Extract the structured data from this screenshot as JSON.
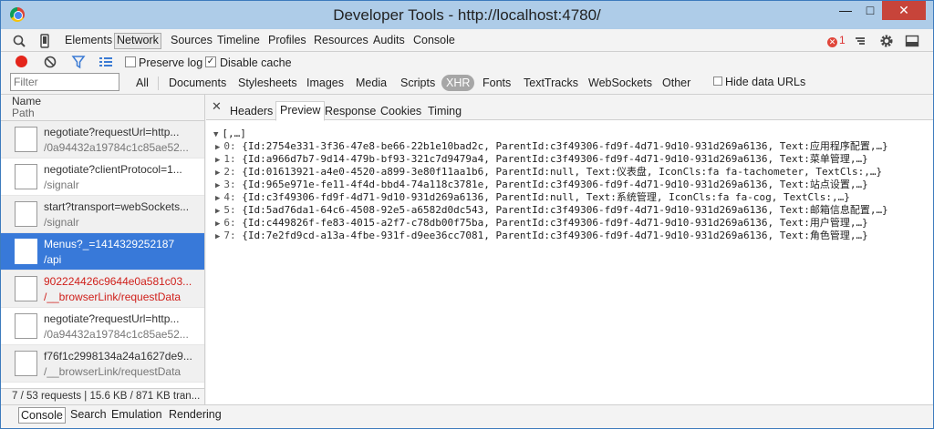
{
  "window": {
    "title": "Developer Tools - http://localhost:4780/"
  },
  "panel_tabs": [
    "Elements",
    "Network",
    "Sources",
    "Timeline",
    "Profiles",
    "Resources",
    "Audits",
    "Console"
  ],
  "error_count": "1",
  "options": {
    "preserve_log": "Preserve log",
    "disable_cache": "Disable cache"
  },
  "filter": {
    "placeholder": "Filter"
  },
  "filter_types": [
    "All",
    "Documents",
    "Stylesheets",
    "Images",
    "Media",
    "Scripts",
    "XHR",
    "Fonts",
    "TextTracks",
    "WebSockets",
    "Other"
  ],
  "hide_data_urls": "Hide data URLs",
  "list": {
    "header_name": "Name",
    "header_path": "Path",
    "requests": [
      {
        "name": "negotiate?requestUrl=http...",
        "path": "/0a94432a19784c1c85ae52..."
      },
      {
        "name": "negotiate?clientProtocol=1...",
        "path": "/signalr"
      },
      {
        "name": "start?transport=webSockets...",
        "path": "/signalr"
      },
      {
        "name": "Menus?_=1414329252187",
        "path": "/api"
      },
      {
        "name": "902224426c9644e0a581c03...",
        "path": "/__browserLink/requestData"
      },
      {
        "name": "negotiate?requestUrl=http...",
        "path": "/0a94432a19784c1c85ae52..."
      },
      {
        "name": "f76f1c2998134a24a1627de9...",
        "path": "/__browserLink/requestData"
      }
    ],
    "status": "7 / 53 requests | 15.6 KB / 871 KB tran..."
  },
  "detail_tabs": [
    "Headers",
    "Preview",
    "Response",
    "Cookies",
    "Timing"
  ],
  "preview": {
    "root": "[,…]",
    "items": [
      {
        "index": "0:",
        "text": "{Id:2754e331-3f36-47e8-be66-22b1e10bad2c, ParentId:c3f49306-fd9f-4d71-9d10-931d269a6136, Text:应用程序配置,…}"
      },
      {
        "index": "1:",
        "text": "{Id:a966d7b7-9d14-479b-bf93-321c7d9479a4, ParentId:c3f49306-fd9f-4d71-9d10-931d269a6136, Text:菜单管理,…}"
      },
      {
        "index": "2:",
        "text": "{Id:01613921-a4e0-4520-a899-3e80f11aa1b6, ParentId:null, Text:仪表盘, IconCls:fa fa-tachometer, TextCls:,…}"
      },
      {
        "index": "3:",
        "text": "{Id:965e971e-fe11-4f4d-bbd4-74a118c3781e, ParentId:c3f49306-fd9f-4d71-9d10-931d269a6136, Text:站点设置,…}"
      },
      {
        "index": "4:",
        "text": "{Id:c3f49306-fd9f-4d71-9d10-931d269a6136, ParentId:null, Text:系统管理, IconCls:fa fa-cog, TextCls:,…}"
      },
      {
        "index": "5:",
        "text": "{Id:5ad76da1-64c6-4508-92e5-a6582d0dc543, ParentId:c3f49306-fd9f-4d71-9d10-931d269a6136, Text:邮箱信息配置,…}"
      },
      {
        "index": "6:",
        "text": "{Id:c449826f-fe83-4015-a2f7-c78db00f75ba, ParentId:c3f49306-fd9f-4d71-9d10-931d269a6136, Text:用户管理,…}"
      },
      {
        "index": "7:",
        "text": "{Id:7e2fd9cd-a13a-4fbe-931f-d9ee36cc7081, ParentId:c3f49306-fd9f-4d71-9d10-931d269a6136, Text:角色管理,…}"
      }
    ]
  },
  "drawer_tabs": [
    "Console",
    "Search",
    "Emulation",
    "Rendering"
  ]
}
